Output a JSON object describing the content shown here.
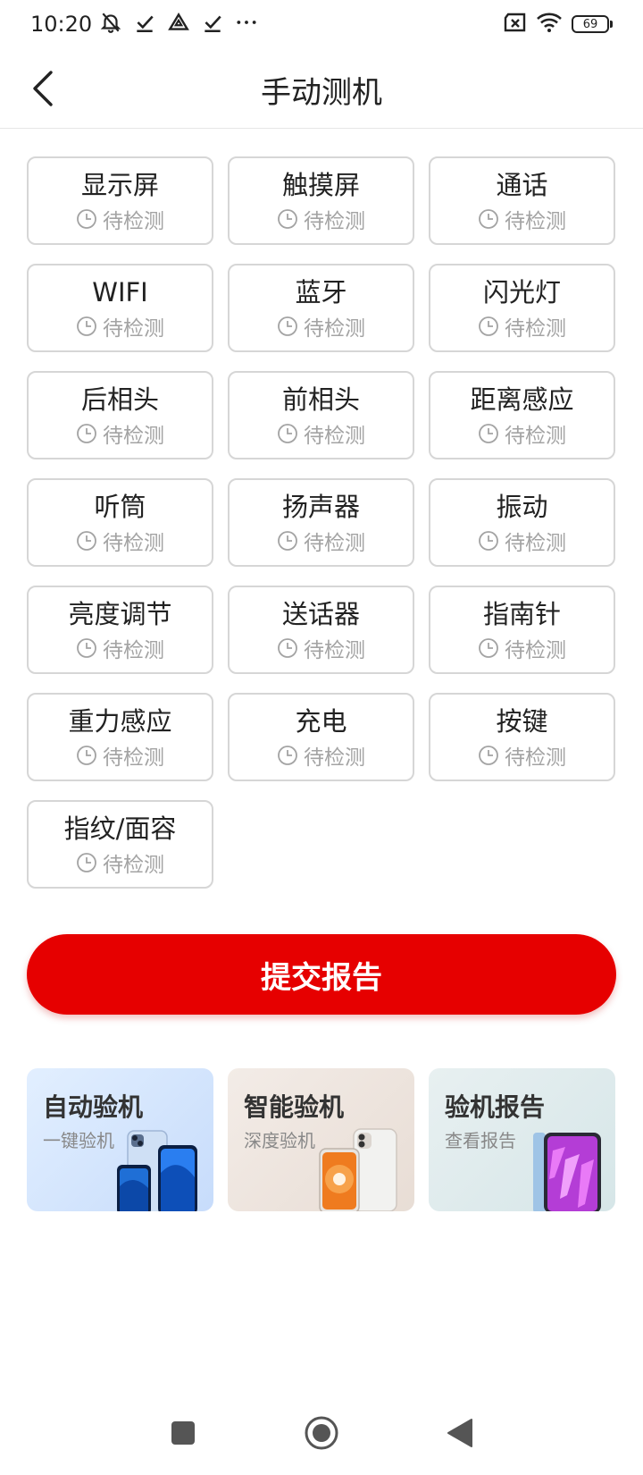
{
  "status_bar": {
    "time": "10:20",
    "battery": "69",
    "icons_left": [
      "mute-icon",
      "check-icon",
      "drive-icon",
      "check-icon",
      "more-icon"
    ],
    "icons_right": [
      "sim-error-icon",
      "wifi-icon",
      "battery-icon"
    ]
  },
  "header": {
    "title": "手动测机"
  },
  "tests": [
    {
      "name": "显示屏",
      "status": "待检测"
    },
    {
      "name": "触摸屏",
      "status": "待检测"
    },
    {
      "name": "通话",
      "status": "待检测"
    },
    {
      "name": "WIFI",
      "status": "待检测"
    },
    {
      "name": "蓝牙",
      "status": "待检测"
    },
    {
      "name": "闪光灯",
      "status": "待检测"
    },
    {
      "name": "后相头",
      "status": "待检测"
    },
    {
      "name": "前相头",
      "status": "待检测"
    },
    {
      "name": "距离感应",
      "status": "待检测"
    },
    {
      "name": "听筒",
      "status": "待检测"
    },
    {
      "name": "扬声器",
      "status": "待检测"
    },
    {
      "name": "振动",
      "status": "待检测"
    },
    {
      "name": "亮度调节",
      "status": "待检测"
    },
    {
      "name": "送话器",
      "status": "待检测"
    },
    {
      "name": "指南针",
      "status": "待检测"
    },
    {
      "name": "重力感应",
      "status": "待检测"
    },
    {
      "name": "充电",
      "status": "待检测"
    },
    {
      "name": "按键",
      "status": "待检测"
    },
    {
      "name": "指纹/面容",
      "status": "待检测"
    }
  ],
  "submit_label": "提交报告",
  "promos": [
    {
      "title": "自动验机",
      "subtitle": "一键验机"
    },
    {
      "title": "智能验机",
      "subtitle": "深度验机"
    },
    {
      "title": "验机报告",
      "subtitle": "查看报告"
    }
  ],
  "colors": {
    "accent": "#e60000",
    "card_border": "#d6d6d6",
    "status_text": "#a3a3a3"
  }
}
